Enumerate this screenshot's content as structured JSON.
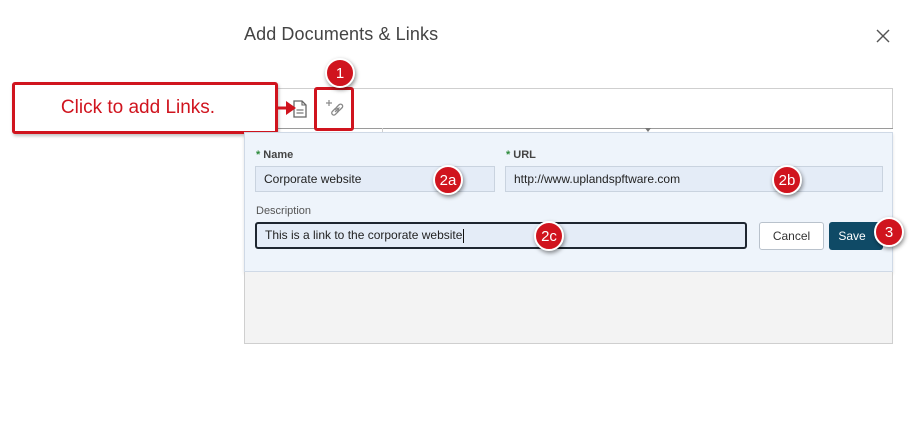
{
  "dialog": {
    "title": "Add Documents & Links",
    "close_icon": "close-icon"
  },
  "toolbar": {
    "document_icon": "document-icon",
    "add_link_icon": "add-link-icon"
  },
  "callout": {
    "text": "Click to add Links."
  },
  "badges": {
    "b1": "1",
    "b2a": "2a",
    "b2b": "2b",
    "b2c": "2c",
    "b3": "3"
  },
  "form": {
    "name": {
      "required_mark": "*",
      "label": "Name",
      "value": "Corporate website"
    },
    "url": {
      "required_mark": "*",
      "label": "URL",
      "value": "http://www.uplandspftware.com"
    },
    "description": {
      "label": "Description",
      "value": "This is a link to the corporate website"
    },
    "cancel_label": "Cancel",
    "save_label": "Save"
  },
  "colors": {
    "annotation_red": "#d0141e",
    "save_button": "#0f4a66",
    "required_green": "#2e8b3c",
    "panel_bg": "#eef4fb",
    "input_bg": "#e4ecf7"
  }
}
